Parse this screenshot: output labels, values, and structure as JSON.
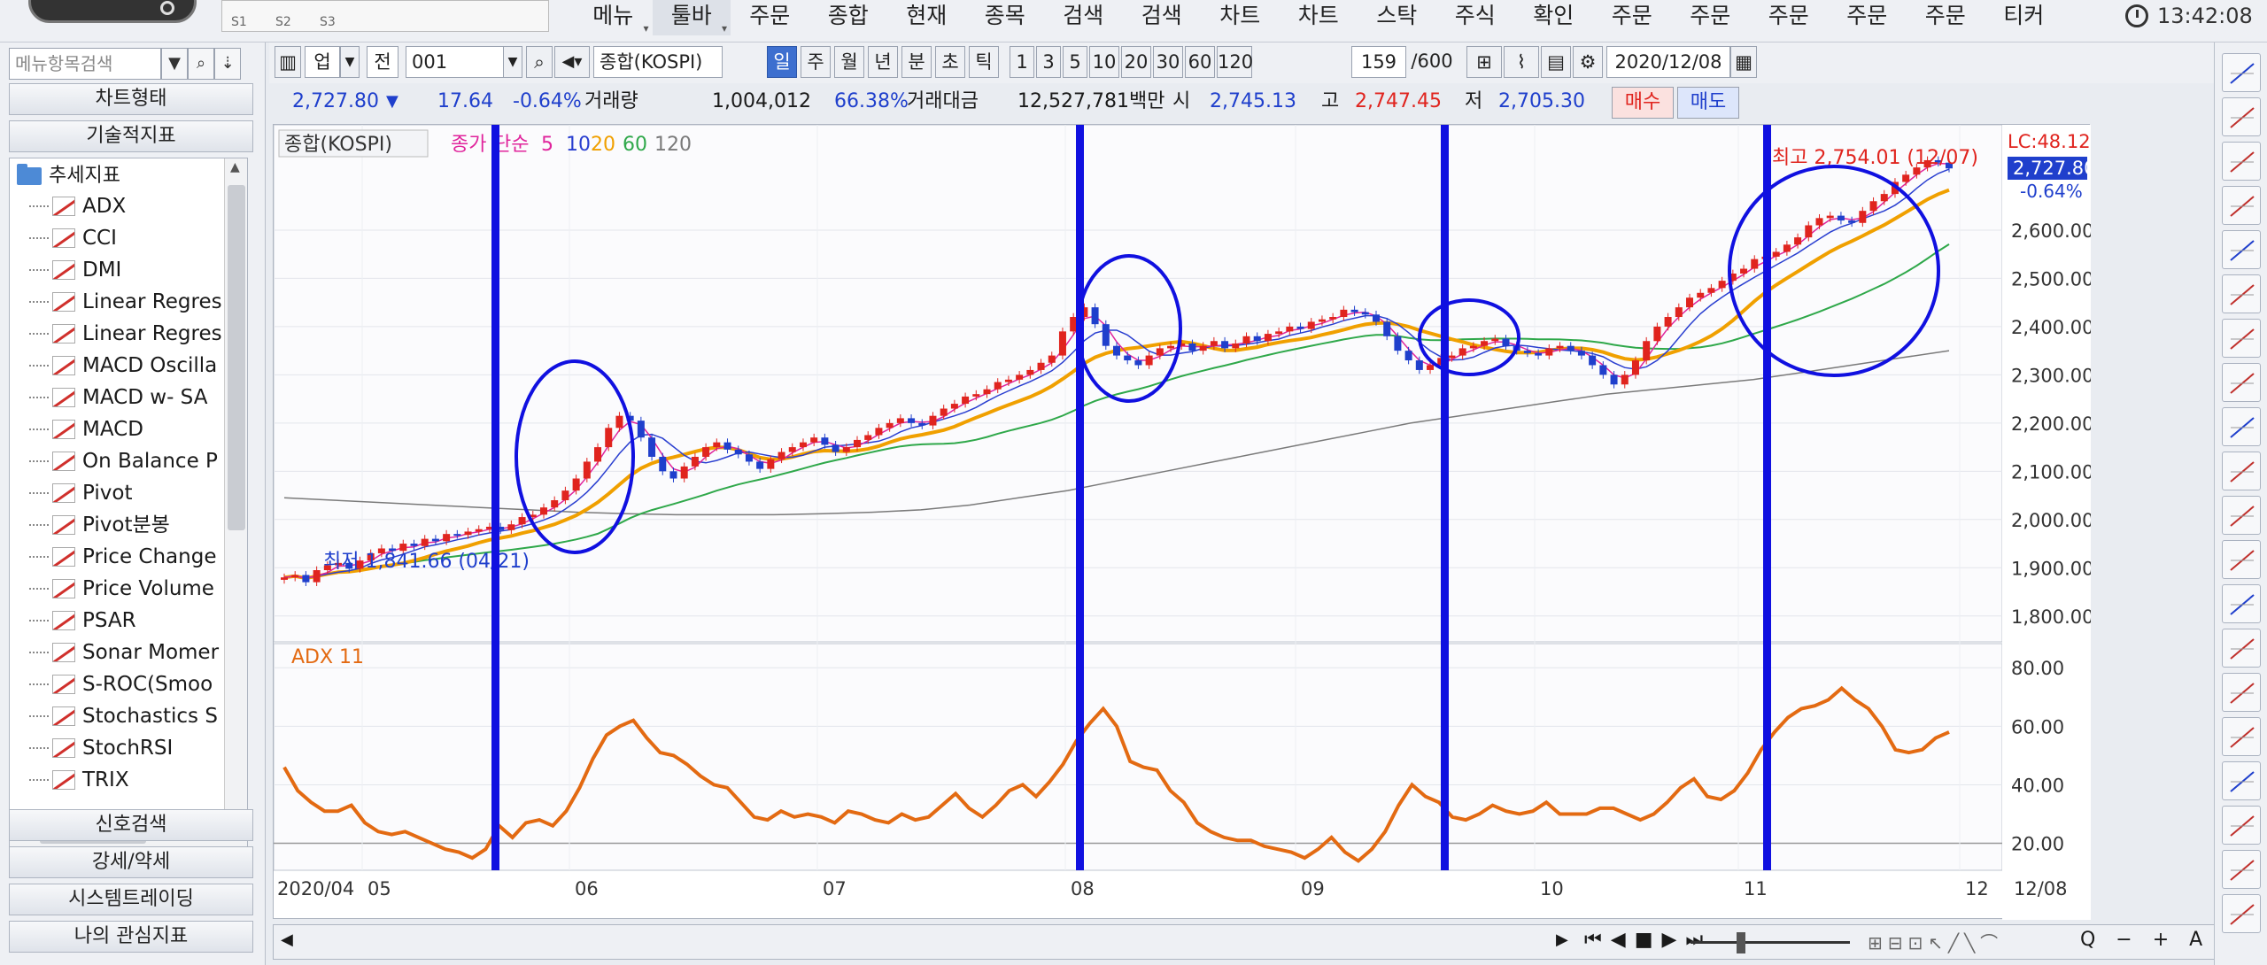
{
  "topbar": {
    "sub_tabs": [
      "S1",
      "S2",
      "S3"
    ],
    "menu": [
      "메뉴",
      "툴바",
      "주문",
      "종합",
      "현재",
      "종목",
      "검색",
      "검색",
      "차트",
      "차트",
      "스탁",
      "주식",
      "확인",
      "주문",
      "주문",
      "주문",
      "주문",
      "주문",
      "티커"
    ],
    "active_menu_index": 1,
    "clock": "13:42:08"
  },
  "left": {
    "search_placeholder": "메뉴항목검색",
    "sections": {
      "chart_type": "차트형태",
      "tech": "기술적지표"
    },
    "tree_root": "추세지표",
    "tree_items": [
      "ADX",
      "CCI",
      "DMI",
      "Linear Regres",
      "Linear Regres",
      "MACD Oscilla",
      "MACD w- SA",
      "MACD",
      "On Balance P",
      "Pivot",
      "Pivot분봉",
      "Price Change",
      "Price Volume",
      "PSAR",
      "Sonar Momer",
      "S-ROC(Smoo",
      "Stochastics S",
      "StochRSI",
      "TRIX"
    ],
    "bottom_headers": [
      "신호검색",
      "강세/약세",
      "시스템트레이딩",
      "나의 관심지표"
    ]
  },
  "toolbar": {
    "market": "업",
    "market2": "전",
    "code": "001",
    "name": "종합(KOSPI)",
    "periods": [
      "일",
      "주",
      "월",
      "년",
      "분",
      "초",
      "틱"
    ],
    "active_period": "일",
    "numbers": [
      "1",
      "3",
      "5",
      "10",
      "20",
      "30",
      "60",
      "120"
    ],
    "count": "159",
    "count_total": "/600",
    "date": "2020/12/08"
  },
  "quote": {
    "price": "2,727.80",
    "change": "17.64",
    "change_pct": "-0.64%",
    "volume_label": "거래량",
    "volume": "1,004,012",
    "volume_pct": "66.38%",
    "amount_label": "거래대금",
    "amount": "12,527,781백만",
    "open_label": "시",
    "open": "2,745.13",
    "high_label": "고",
    "high": "2,747.45",
    "low_label": "저",
    "low": "2,705.30",
    "buy": "매수",
    "sell": "매도"
  },
  "chart_data": [
    {
      "type": "candlestick",
      "title": "종합(KOSPI)",
      "legend": {
        "price": "종가",
        "ma_type": "단순",
        "ma_periods": [
          "5",
          "10",
          "20",
          "60",
          "120"
        ]
      },
      "ma_colors": {
        "5": "#e0249c",
        "10": "#2a3fd0",
        "20": "#f0a000",
        "60": "#2fa84a",
        "120": "#7a7a7a"
      },
      "candle_colors": {
        "up": "#e0241e",
        "down": "#1f3fcc"
      },
      "ylim": [
        1750,
        2800
      ],
      "y_ticks": [
        "2,600.00",
        "2,500.00",
        "2,400.00",
        "2,300.00",
        "2,200.00",
        "2,100.00",
        "2,000.00",
        "1,900.00",
        "1,800.00"
      ],
      "y_tick_values": [
        2600,
        2500,
        2400,
        2300,
        2200,
        2100,
        2000,
        1900,
        1800
      ],
      "high_annotation": "최고 2,754.01 (12/07)",
      "low_annotation": "최저 1,841.66 (04/21)",
      "top_right": "LC:48.12",
      "last_price_label": "2,727.80",
      "last_pct_label": "-0.64%",
      "x_labels": [
        "2020/04",
        "05",
        "06",
        "07",
        "08",
        "09",
        "10",
        "11",
        "12",
        "12/08"
      ],
      "close": [
        1880,
        1885,
        1870,
        1895,
        1905,
        1910,
        1898,
        1915,
        1930,
        1940,
        1935,
        1950,
        1945,
        1960,
        1955,
        1970,
        1968,
        1975,
        1980,
        1985,
        1978,
        1990,
        2005,
        2010,
        2025,
        2040,
        2060,
        2085,
        2120,
        2150,
        2190,
        2215,
        2205,
        2170,
        2130,
        2100,
        2085,
        2110,
        2130,
        2150,
        2160,
        2145,
        2135,
        2120,
        2105,
        2125,
        2140,
        2150,
        2160,
        2170,
        2155,
        2140,
        2150,
        2165,
        2175,
        2190,
        2200,
        2210,
        2200,
        2195,
        2215,
        2230,
        2240,
        2255,
        2260,
        2270,
        2285,
        2290,
        2300,
        2310,
        2325,
        2340,
        2390,
        2420,
        2440,
        2405,
        2360,
        2340,
        2330,
        2320,
        2340,
        2355,
        2360,
        2365,
        2350,
        2360,
        2370,
        2355,
        2365,
        2380,
        2370,
        2385,
        2390,
        2400,
        2395,
        2410,
        2415,
        2420,
        2435,
        2430,
        2425,
        2410,
        2380,
        2350,
        2330,
        2310,
        2320,
        2335,
        2340,
        2355,
        2360,
        2370,
        2375,
        2360,
        2350,
        2345,
        2340,
        2355,
        2360,
        2350,
        2340,
        2320,
        2300,
        2280,
        2300,
        2330,
        2370,
        2400,
        2420,
        2440,
        2460,
        2470,
        2480,
        2495,
        2510,
        2520,
        2540,
        2545,
        2555,
        2570,
        2585,
        2610,
        2625,
        2630,
        2620,
        2615,
        2640,
        2660,
        2675,
        2700,
        2715,
        2730,
        2745,
        2740,
        2728
      ],
      "ma120": [
        2045,
        2040,
        2035,
        2030,
        2025,
        2020,
        2015,
        2012,
        2010,
        2010,
        2010,
        2012,
        2015,
        2020,
        2030,
        2045,
        2060,
        2080,
        2100,
        2120,
        2140,
        2160,
        2180,
        2200,
        2215,
        2230,
        2245,
        2260,
        2270,
        2280,
        2290,
        2305,
        2320,
        2335,
        2350
      ],
      "adx": {
        "title": "ADX 11",
        "ylim": [
          12,
          84
        ],
        "y_ticks": [
          "80.00",
          "60.00",
          "40.00",
          "20.00"
        ],
        "y_tick_values": [
          80,
          60,
          40,
          20
        ],
        "values": [
          46,
          38,
          34,
          31,
          31,
          33,
          27,
          24,
          23,
          24,
          22,
          20,
          18,
          17,
          15,
          18,
          26,
          22,
          27,
          28,
          26,
          31,
          39,
          49,
          57,
          60,
          62,
          56,
          51,
          50,
          47,
          43,
          40,
          39,
          34,
          29,
          28,
          31,
          29,
          30,
          29,
          27,
          31,
          30,
          28,
          27,
          30,
          28,
          29,
          33,
          37,
          32,
          29,
          33,
          38,
          40,
          36,
          41,
          47,
          55,
          61,
          66,
          60,
          48,
          46,
          45,
          38,
          34,
          27,
          24,
          22,
          21,
          21,
          19,
          18,
          17,
          15,
          18,
          22,
          17,
          14,
          18,
          24,
          33,
          40,
          36,
          34,
          29,
          28,
          30,
          33,
          31,
          30,
          31,
          34,
          30,
          30,
          30,
          32,
          32,
          30,
          28,
          30,
          34,
          39,
          42,
          36,
          35,
          38,
          44,
          52,
          58,
          63,
          66,
          67,
          69,
          73,
          69,
          66,
          60,
          52,
          51,
          52,
          56,
          58
        ]
      },
      "vertical_markers_x": [
        "05/22",
        "08/01",
        "09/22",
        "11/03"
      ],
      "circles": [
        "06 rise",
        "08 rise",
        "09-10 dip",
        "11-12 rise"
      ]
    }
  ],
  "bottom": {
    "controls": [
      "◀",
      "▶",
      "■",
      "▶▶"
    ],
    "zoom_label": "Q − + A"
  }
}
